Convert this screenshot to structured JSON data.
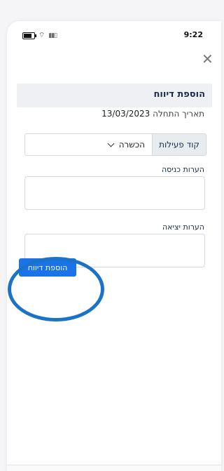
{
  "status_bar": {
    "time": "9:22"
  },
  "form": {
    "title": "הוספת דיווח",
    "date_label": "תאריך התחלה",
    "date_value": "13/03/2023",
    "activity_code_label": "קוד פעילות",
    "activity_code_value": "הכשרה",
    "entry_notes_label": "הערות כניסה",
    "exit_notes_label": "הערות יציאה",
    "submit_label": "הוספת דיווח"
  },
  "colors": {
    "primary": "#1a73e8",
    "highlight_ring": "#1a73c8",
    "header_bg": "#eef0f3"
  },
  "icons": {
    "close": "close-icon",
    "chevron": "chevron-down-icon",
    "wifi": "wifi-icon",
    "battery": "battery-icon",
    "signal": "signal-icon"
  }
}
